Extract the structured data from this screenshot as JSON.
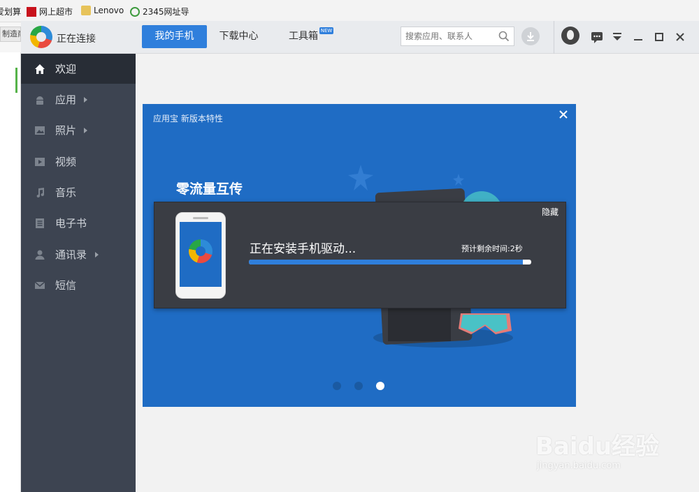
{
  "browser": {
    "bookmarks": [
      {
        "label": "爱划算",
        "icon": "bookmark-icon"
      },
      {
        "label": "网上超市",
        "icon": "red-bookmark-icon"
      },
      {
        "label": "Lenovo",
        "icon": "folder-icon"
      },
      {
        "label": "2345网址导",
        "icon": "nav-site-icon"
      }
    ],
    "tab_label": "制造商"
  },
  "app": {
    "status_title": "正在连接",
    "nav_tabs": [
      {
        "label": "我的手机",
        "active": true
      },
      {
        "label": "下载中心",
        "active": false
      },
      {
        "label": "工具箱",
        "active": false
      }
    ],
    "new_badge": "NEW",
    "search_placeholder": "搜索应用、联系人"
  },
  "sidebar": {
    "items": [
      {
        "label": "欢迎",
        "icon": "home-icon",
        "active": true,
        "has_arrow": false
      },
      {
        "label": "应用",
        "icon": "android-icon",
        "active": false,
        "has_arrow": true
      },
      {
        "label": "照片",
        "icon": "photo-icon",
        "active": false,
        "has_arrow": true
      },
      {
        "label": "视频",
        "icon": "video-icon",
        "active": false,
        "has_arrow": false
      },
      {
        "label": "音乐",
        "icon": "music-icon",
        "active": false,
        "has_arrow": false
      },
      {
        "label": "电子书",
        "icon": "book-icon",
        "active": false,
        "has_arrow": false
      },
      {
        "label": "通讯录",
        "icon": "contacts-icon",
        "active": false,
        "has_arrow": true
      },
      {
        "label": "短信",
        "icon": "sms-icon",
        "active": false,
        "has_arrow": false
      }
    ]
  },
  "popup": {
    "title": "应用宝 新版本特性",
    "heading": "零流量互传",
    "subtitle": "",
    "dots": 3,
    "active_dot": 2
  },
  "install": {
    "hide_label": "隐藏",
    "message": "正在安装手机驱动...",
    "eta": "预计剩余时间:2秒",
    "progress": 0.97
  },
  "watermark": {
    "text": "Baidu经验",
    "sub": "jingyan.baidu.com"
  },
  "colors": {
    "accent": "#2f7fdc",
    "sidebar": "#3d4451",
    "popup": "#1f6cc4"
  }
}
